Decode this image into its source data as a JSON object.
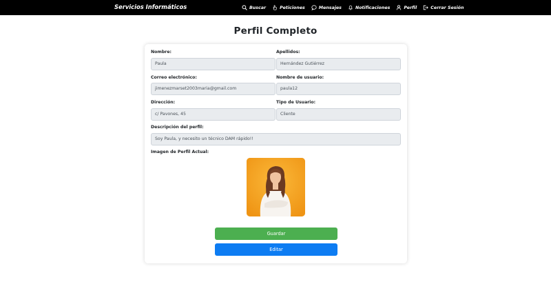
{
  "navbar": {
    "brand": "Servicios Informáticos",
    "items": [
      {
        "label": "Buscar",
        "icon": "search-icon"
      },
      {
        "label": "Peticiones",
        "icon": "hand-icon"
      },
      {
        "label": "Mensajes",
        "icon": "chat-icon"
      },
      {
        "label": "Notificaciones",
        "icon": "bell-icon"
      },
      {
        "label": "Perfil",
        "icon": "user-icon"
      },
      {
        "label": "Cerrar Sesión",
        "icon": "logout-icon"
      }
    ]
  },
  "page": {
    "title": "Perfil Completo"
  },
  "form": {
    "nombre": {
      "label": "Nombre:",
      "value": "Paula"
    },
    "apellidos": {
      "label": "Apellidos:",
      "value": "Hernández Gutiérrez"
    },
    "correo": {
      "label": "Correo electrónico:",
      "value": "jimenezmarset2003maria@gmail.com"
    },
    "usuario": {
      "label": "Nombre de usuario:",
      "value": "paula12"
    },
    "direccion": {
      "label": "Dirección:",
      "value": "c/ Pavones, 45"
    },
    "tipo": {
      "label": "Tipo de Usuario:",
      "value": "Cliente"
    },
    "descripcion": {
      "label": "Descripción del perfil:",
      "value": "Soy Paula, y necesito un técnico DAM rápido!!"
    },
    "imagen": {
      "label": "Imagen de Perfil Actual:"
    }
  },
  "buttons": {
    "save": "Guardar",
    "edit": "Editar"
  },
  "colors": {
    "navbar_bg": "#000000",
    "field_bg": "#e9ecef",
    "save_button": "#4caf50",
    "edit_button": "#0d7cf2",
    "photo_bg": "#f5a31a"
  }
}
